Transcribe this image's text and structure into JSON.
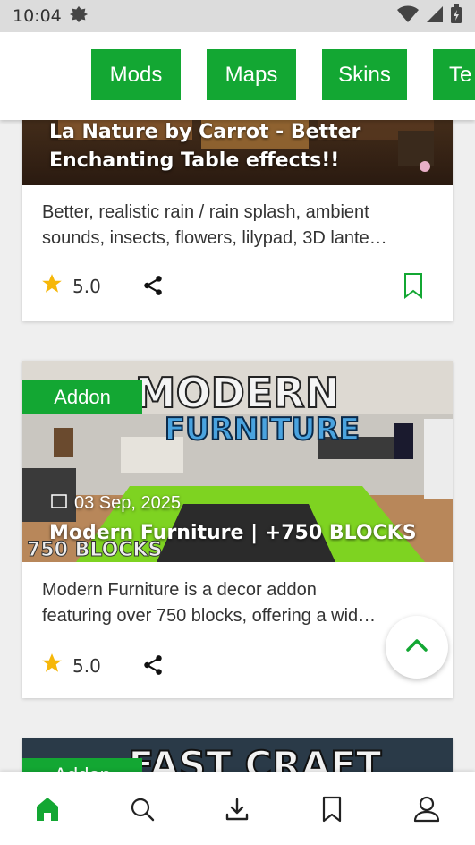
{
  "status_bar": {
    "time": "10:04"
  },
  "chips": [
    "Mods",
    "Maps",
    "Skins",
    "Te"
  ],
  "cards": [
    {
      "title_lines": [
        "La Nature by Carrot - Better",
        "Enchanting Table effects!!"
      ],
      "description_lines": [
        "Better, realistic rain / rain splash, ambient",
        "sounds, insects, flowers, lilypad, 3D lante…"
      ],
      "rating": "5.0"
    },
    {
      "badge": "Addon",
      "image_text": {
        "line1": "MODERN",
        "line2": "FURNITURE",
        "corner": "750 BLOCKS"
      },
      "date": "03 Sep, 2025",
      "title": "Modern Furniture | +750 BLOCKS",
      "description_lines": [
        "Modern Furniture is a decor addon",
        "featuring over 750 blocks, offering a wid…"
      ],
      "rating": "5.0"
    },
    {
      "badge": "Addon",
      "image_text": "FAST CRAFT"
    }
  ],
  "colors": {
    "accent": "#13a733",
    "star": "#f6b70a"
  },
  "icons": {
    "status": [
      "gear-icon",
      "wifi-icon",
      "signal-icon",
      "battery-icon"
    ],
    "card": [
      "star-icon",
      "share-icon",
      "bookmark-icon"
    ],
    "fab": "chevron-up-icon",
    "bottom_nav": [
      "home-icon",
      "search-icon",
      "download-icon",
      "bookmark-icon",
      "profile-icon"
    ]
  },
  "bottom_nav": {
    "active": "home"
  }
}
